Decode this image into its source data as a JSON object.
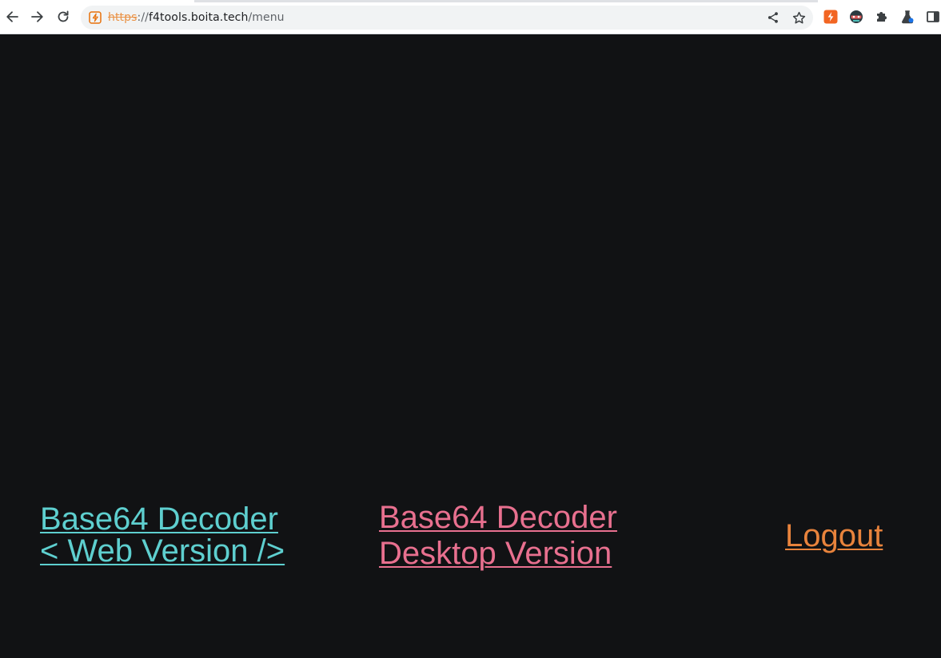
{
  "browser": {
    "url": {
      "scheme": "https",
      "separator": "://",
      "host": "f4tools.boita.tech",
      "path": "/menu"
    },
    "icons": {
      "back": "arrow-left-icon",
      "forward": "arrow-right-icon",
      "reload": "reload-icon",
      "site_security": "not-secure-icon",
      "share": "share-icon",
      "bookmark": "star-icon",
      "extensions": [
        "lightning-extension-icon",
        "mask-extension-icon",
        "puzzle-icon",
        "lab-flask-icon",
        "side-panel-icon"
      ]
    }
  },
  "page": {
    "background": "#111214",
    "links": {
      "web_version": {
        "line1": "Base64 Decoder",
        "line2": "< Web Version />",
        "color": "#5ecfcf"
      },
      "desktop_version": {
        "line1": "Base64 Decoder",
        "line2": "Desktop Version",
        "color": "#e8708f"
      },
      "logout": {
        "label": "Logout",
        "color": "#e8833c"
      }
    }
  }
}
